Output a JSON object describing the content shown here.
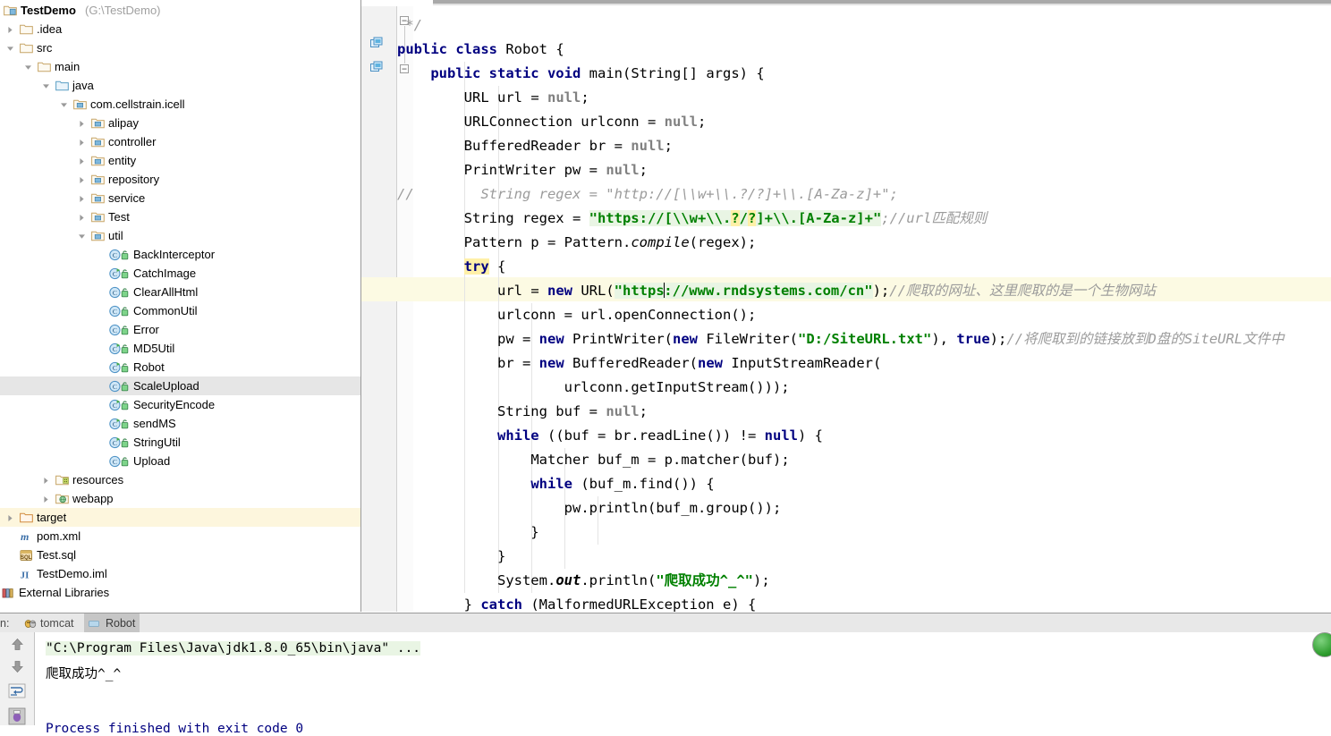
{
  "project": {
    "name": "TestDemo",
    "path": "(G:\\TestDemo)",
    "tree": [
      {
        "label": ".idea",
        "indent": 0,
        "arrow": "right",
        "icon": "folder",
        "depth": 1
      },
      {
        "label": "src",
        "indent": 0,
        "arrow": "down",
        "icon": "folder",
        "depth": 1
      },
      {
        "label": "main",
        "indent": 1,
        "arrow": "down",
        "icon": "folder",
        "depth": 2
      },
      {
        "label": "java",
        "indent": 2,
        "arrow": "down",
        "icon": "folder-source",
        "depth": 3
      },
      {
        "label": "com.cellstrain.icell",
        "indent": 3,
        "arrow": "down",
        "icon": "folder-package",
        "depth": 4
      },
      {
        "label": "alipay",
        "indent": 4,
        "arrow": "right",
        "icon": "folder-package",
        "depth": 5
      },
      {
        "label": "controller",
        "indent": 4,
        "arrow": "right",
        "icon": "folder-package",
        "depth": 5
      },
      {
        "label": "entity",
        "indent": 4,
        "arrow": "right",
        "icon": "folder-package",
        "depth": 5
      },
      {
        "label": "repository",
        "indent": 4,
        "arrow": "right",
        "icon": "folder-package",
        "depth": 5
      },
      {
        "label": "service",
        "indent": 4,
        "arrow": "right",
        "icon": "folder-package",
        "depth": 5
      },
      {
        "label": "Test",
        "indent": 4,
        "arrow": "right",
        "icon": "folder-package",
        "depth": 5
      },
      {
        "label": "util",
        "indent": 4,
        "arrow": "down",
        "icon": "folder-package",
        "depth": 5
      },
      {
        "label": "BackInterceptor",
        "indent": 5,
        "arrow": "none",
        "icon": "java-class",
        "depth": 6
      },
      {
        "label": "CatchImage",
        "indent": 5,
        "arrow": "none",
        "icon": "java-class-run",
        "depth": 6
      },
      {
        "label": "ClearAllHtml",
        "indent": 5,
        "arrow": "none",
        "icon": "java-class",
        "depth": 6
      },
      {
        "label": "CommonUtil",
        "indent": 5,
        "arrow": "none",
        "icon": "java-class",
        "depth": 6
      },
      {
        "label": "Error",
        "indent": 5,
        "arrow": "none",
        "icon": "java-class",
        "depth": 6
      },
      {
        "label": "MD5Util",
        "indent": 5,
        "arrow": "none",
        "icon": "java-class-run",
        "depth": 6
      },
      {
        "label": "Robot",
        "indent": 5,
        "arrow": "none",
        "icon": "java-class-run",
        "depth": 6
      },
      {
        "label": "ScaleUpload",
        "indent": 5,
        "arrow": "none",
        "icon": "java-class",
        "depth": 6,
        "state": "selected"
      },
      {
        "label": "SecurityEncode",
        "indent": 5,
        "arrow": "none",
        "icon": "java-class-run",
        "depth": 6
      },
      {
        "label": "sendMS",
        "indent": 5,
        "arrow": "none",
        "icon": "java-class-run",
        "depth": 6
      },
      {
        "label": "StringUtil",
        "indent": 5,
        "arrow": "none",
        "icon": "java-class-run",
        "depth": 6
      },
      {
        "label": "Upload",
        "indent": 5,
        "arrow": "none",
        "icon": "java-class",
        "depth": 6
      },
      {
        "label": "resources",
        "indent": 2,
        "arrow": "right",
        "icon": "folder-resource",
        "depth": 3
      },
      {
        "label": "webapp",
        "indent": 2,
        "arrow": "right",
        "icon": "folder-web",
        "depth": 3
      },
      {
        "label": "target",
        "indent": 0,
        "arrow": "right",
        "icon": "folder-excluded",
        "depth": 1,
        "state": "excluded"
      },
      {
        "label": "pom.xml",
        "indent": 0,
        "arrow": "none",
        "icon": "maven",
        "depth": 1
      },
      {
        "label": "Test.sql",
        "indent": 0,
        "arrow": "none",
        "icon": "sql",
        "depth": 1
      },
      {
        "label": "TestDemo.iml",
        "indent": 0,
        "arrow": "none",
        "icon": "iml",
        "depth": 1
      },
      {
        "label": "External Libraries",
        "indent": -1,
        "arrow": "none",
        "icon": "libraries",
        "depth": 0
      }
    ]
  },
  "editor": {
    "file": "Robot",
    "caret_after": "https",
    "lines": [
      " */",
      "public class Robot {",
      "    public static void main(String[] args) {",
      "        URL url = null;",
      "        URLConnection urlconn = null;",
      "        BufferedReader br = null;",
      "        PrintWriter pw = null;",
      "//        String regex = \"http://[\\\\w+\\\\.?/?]+\\\\.[A-Za-z]+\";",
      "        String regex = \"https://[\\\\w+\\\\.?/?]+\\\\.[A-Za-z]+\";//url匹配规则",
      "        Pattern p = Pattern.compile(regex);",
      "        try {",
      "            url = new URL(\"https://www.rndsystems.com/cn\");//爬取的网址、这里爬取的是一个生物网站",
      "            urlconn = url.openConnection();",
      "            pw = new PrintWriter(new FileWriter(\"D:/SiteURL.txt\"), true);//将爬取到的链接放到D盘的SiteURL文件中",
      "            br = new BufferedReader(new InputStreamReader(",
      "                    urlconn.getInputStream()));",
      "            String buf = null;",
      "            while ((buf = br.readLine()) != null) {",
      "                Matcher buf_m = p.matcher(buf);",
      "                while (buf_m.find()) {",
      "                    pw.println(buf_m.group());",
      "                }",
      "            }",
      "            System.out.println(\"爬取成功^_^\");",
      "        } catch (MalformedURLException e) {"
    ],
    "comment_url_regex": "//url匹配规则",
    "comment_site": "//爬取的网址、这里爬取的是一个生物网站",
    "comment_file": "//将爬取到的链接放到D盘的SiteURL文件中",
    "success_string": "爬取成功^_^"
  },
  "console": {
    "run_label": "n:",
    "tabs": [
      {
        "label": "tomcat",
        "icon": "tomcat-icon",
        "active": false
      },
      {
        "label": "Robot",
        "icon": "run-icon",
        "active": true
      }
    ],
    "toolbar": [
      {
        "name": "scroll-up-icon"
      },
      {
        "name": "scroll-down-icon"
      },
      {
        "name": "soft-wrap-icon"
      },
      {
        "name": "print-icon"
      }
    ],
    "output": [
      {
        "text": "\"C:\\Program Files\\Java\\jdk1.8.0_65\\bin\\java\" ...",
        "style": "green"
      },
      {
        "text": "爬取成功^_^",
        "style": "black"
      },
      {
        "text": "Process finished with exit code 0",
        "style": "blue"
      }
    ],
    "run_button": "green-run-indicator"
  },
  "colors": {
    "keyword": "#000080",
    "string": "#008000",
    "comment": "#9b9b9b",
    "selection": "#e6e6e6",
    "excluded_row": "#fdf6dd",
    "caret_line": "#fcfae3"
  }
}
